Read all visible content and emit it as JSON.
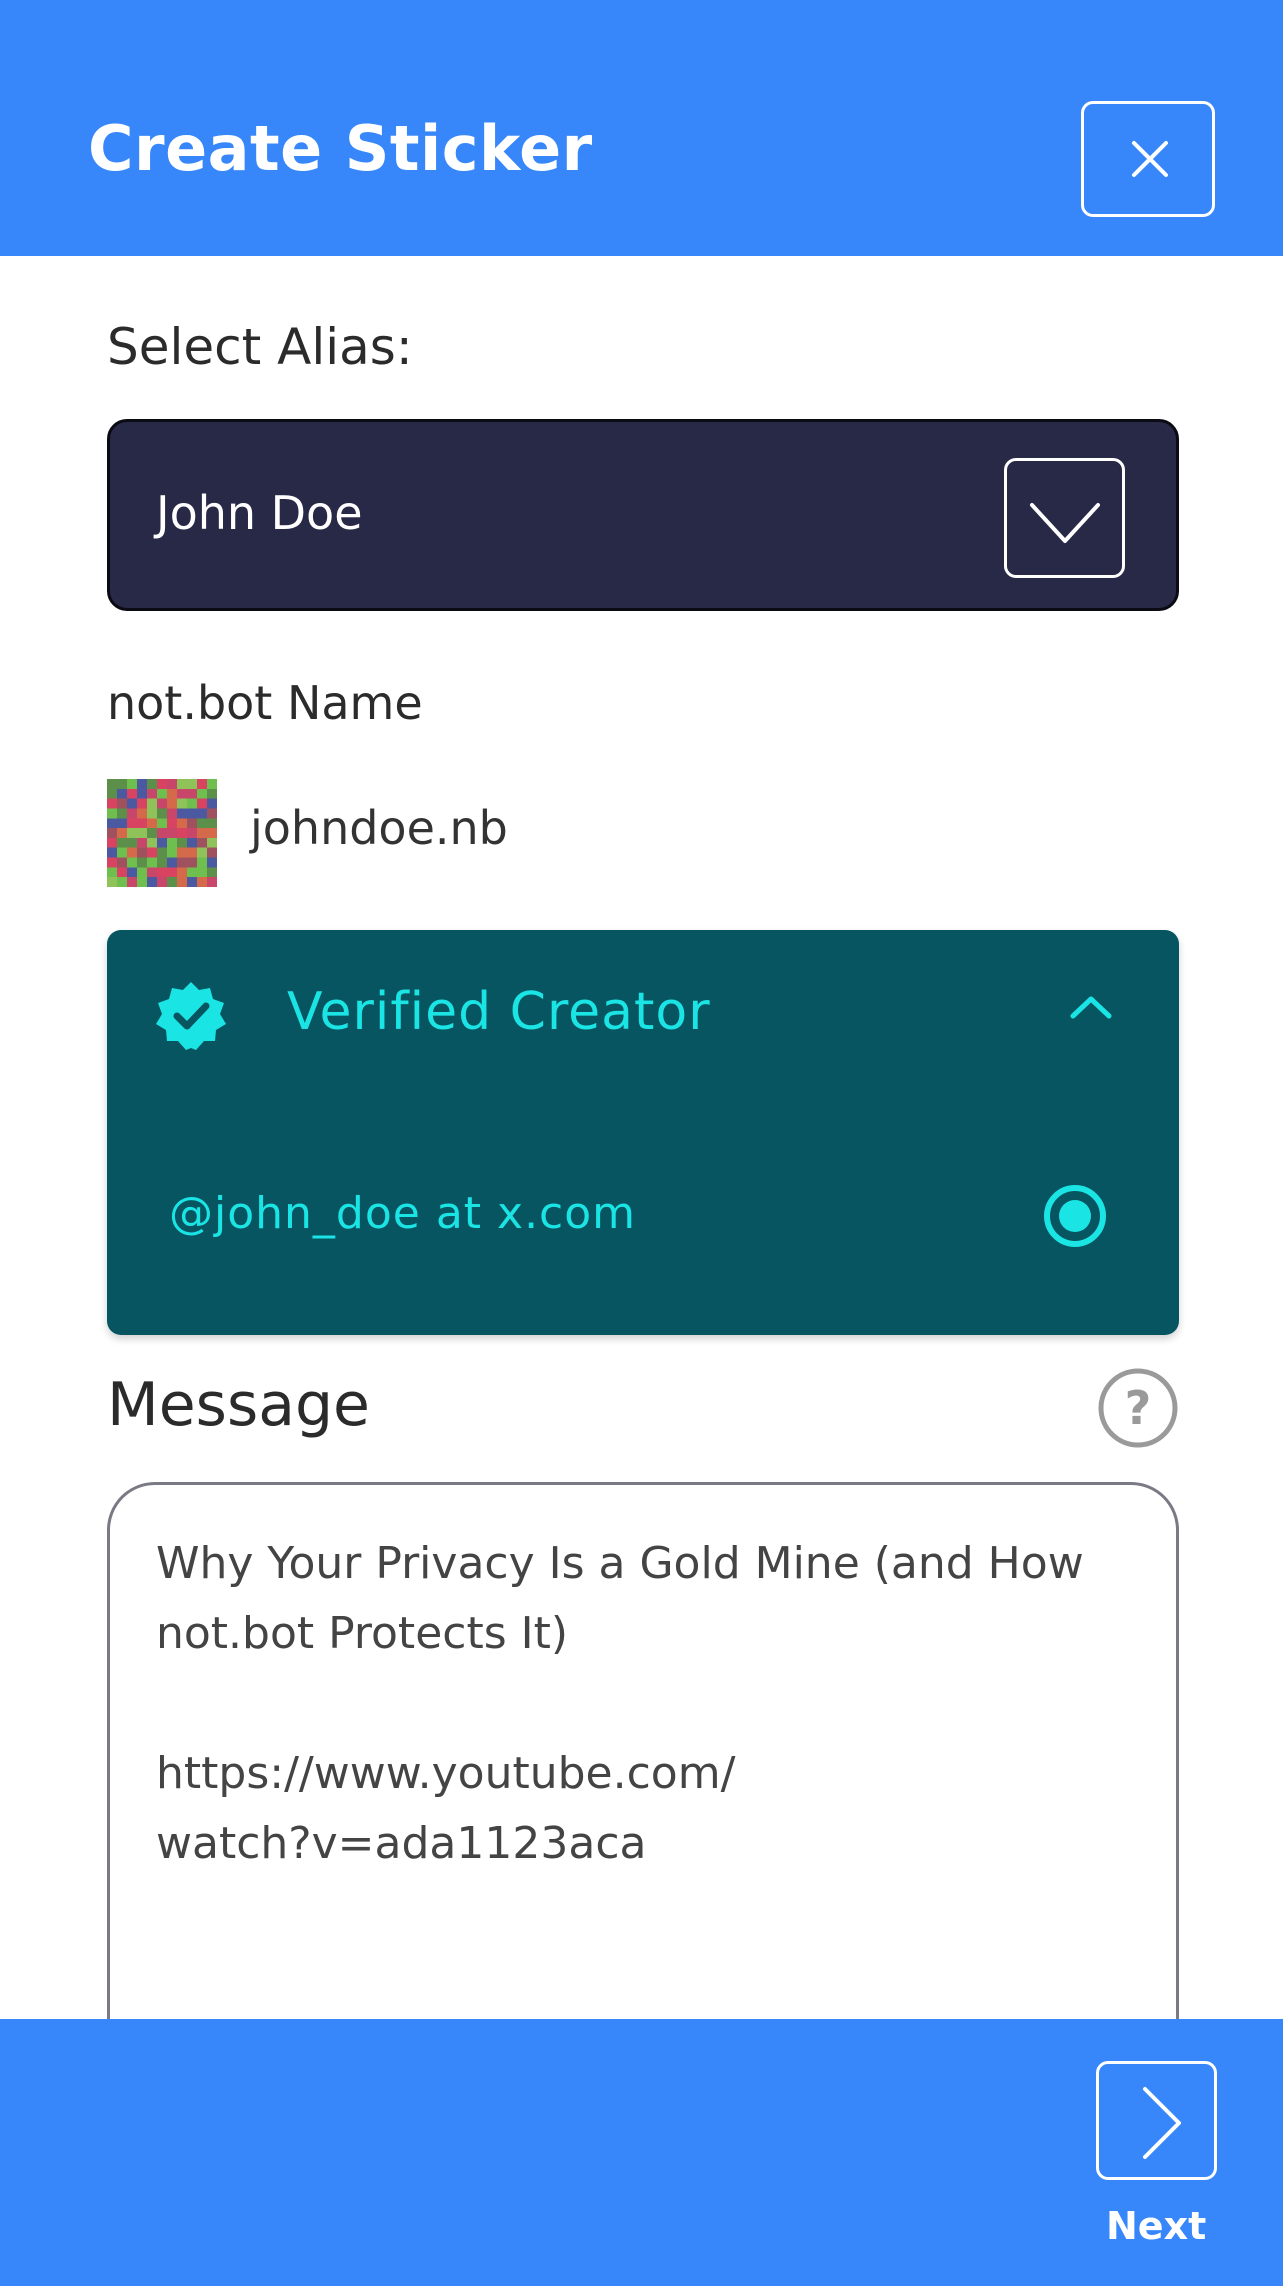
{
  "header": {
    "title": "Create Sticker",
    "close_icon": "close-icon",
    "background_color": "#3787fb"
  },
  "alias": {
    "label": "Select Alias:",
    "selected_value": "John Doe",
    "dropdown_icon": "chevron-down-icon"
  },
  "notbot": {
    "label": "not.bot Name",
    "name": "johndoe.nb",
    "avatar_icon": "pixel-avatar"
  },
  "verified": {
    "title": "Verified Creator",
    "badge_icon": "verified-badge-icon",
    "expand_icon": "chevron-up-icon",
    "handle": "@john_doe at x.com",
    "handle_selected": true,
    "panel_color": "#075561",
    "accent_color": "#1ae4e4"
  },
  "message": {
    "label": "Message",
    "help_icon": "question-icon",
    "text": "Why Your Privacy Is a Gold Mine (and How not.bot Protects It)\n\nhttps://www.youtube.com/\nwatch?v=ada1123aca"
  },
  "footer": {
    "next_label": "Next",
    "next_icon": "chevron-right-icon"
  }
}
